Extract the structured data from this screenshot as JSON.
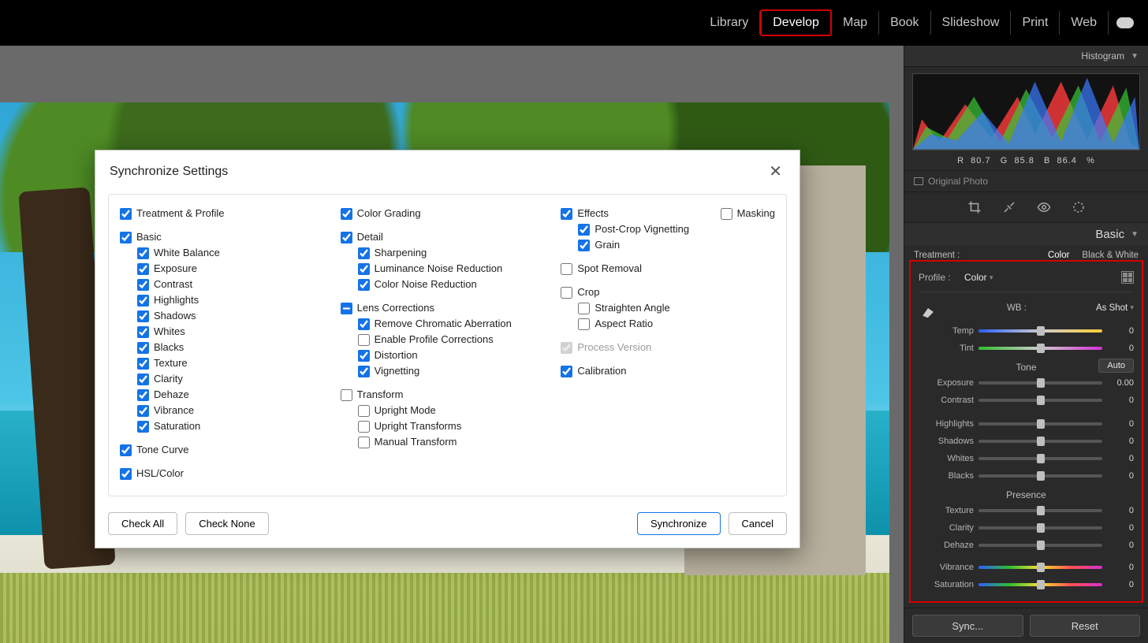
{
  "modules": {
    "library": "Library",
    "develop": "Develop",
    "map": "Map",
    "book": "Book",
    "slideshow": "Slideshow",
    "print": "Print",
    "web": "Web"
  },
  "panel": {
    "histogram": "Histogram",
    "rgb": {
      "rL": "R",
      "r": "80.7",
      "gL": "G",
      "g": "85.8",
      "bL": "B",
      "b": "86.4",
      "pct": "%"
    },
    "original": "Original Photo",
    "basic": "Basic",
    "treatmentLabel": "Treatment :",
    "treatColor": "Color",
    "treatBW": "Black & White",
    "profileLabel": "Profile :",
    "profileValue": "Color",
    "wbLabel": "WB :",
    "wbValue": "As Shot",
    "toneTitle": "Tone",
    "auto": "Auto",
    "presenceTitle": "Presence",
    "sliders": {
      "temp": {
        "l": "Temp",
        "v": "0"
      },
      "tint": {
        "l": "Tint",
        "v": "0"
      },
      "exposure": {
        "l": "Exposure",
        "v": "0.00"
      },
      "contrast": {
        "l": "Contrast",
        "v": "0"
      },
      "highlights": {
        "l": "Highlights",
        "v": "0"
      },
      "shadows": {
        "l": "Shadows",
        "v": "0"
      },
      "whites": {
        "l": "Whites",
        "v": "0"
      },
      "blacks": {
        "l": "Blacks",
        "v": "0"
      },
      "texture": {
        "l": "Texture",
        "v": "0"
      },
      "clarity": {
        "l": "Clarity",
        "v": "0"
      },
      "dehaze": {
        "l": "Dehaze",
        "v": "0"
      },
      "vibrance": {
        "l": "Vibrance",
        "v": "0"
      },
      "saturation": {
        "l": "Saturation",
        "v": "0"
      }
    },
    "sync": "Sync...",
    "reset": "Reset"
  },
  "dialog": {
    "title": "Synchronize Settings",
    "checkAll": "Check All",
    "checkNone": "Check None",
    "synchronize": "Synchronize",
    "cancel": "Cancel",
    "c1": {
      "treatment": "Treatment & Profile",
      "basic": "Basic",
      "wb": "White Balance",
      "exposure": "Exposure",
      "contrast": "Contrast",
      "highlights": "Highlights",
      "shadows": "Shadows",
      "whites": "Whites",
      "blacks": "Blacks",
      "texture": "Texture",
      "clarity": "Clarity",
      "dehaze": "Dehaze",
      "vibrance": "Vibrance",
      "saturation": "Saturation",
      "tonecurve": "Tone Curve",
      "hsl": "HSL/Color"
    },
    "c2": {
      "colorgrading": "Color Grading",
      "detail": "Detail",
      "sharpening": "Sharpening",
      "lumnr": "Luminance Noise Reduction",
      "colnr": "Color Noise Reduction",
      "lens": "Lens Corrections",
      "chroma": "Remove Chromatic Aberration",
      "enableprof": "Enable Profile Corrections",
      "distortion": "Distortion",
      "vignetting": "Vignetting",
      "transform": "Transform",
      "upmode": "Upright Mode",
      "uptrans": "Upright Transforms",
      "manual": "Manual Transform"
    },
    "c3": {
      "effects": "Effects",
      "postcrop": "Post-Crop Vignetting",
      "grain": "Grain",
      "spot": "Spot Removal",
      "crop": "Crop",
      "straight": "Straighten Angle",
      "aspect": "Aspect Ratio",
      "process": "Process Version",
      "calibration": "Calibration",
      "masking": "Masking"
    }
  }
}
